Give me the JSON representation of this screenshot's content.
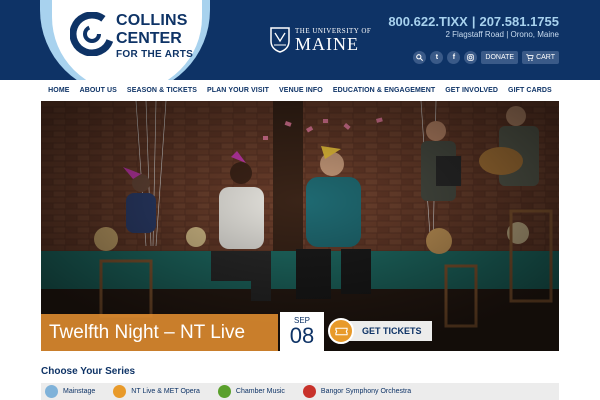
{
  "brand": {
    "logo_line1": "COLLINS",
    "logo_line2": "CENTER",
    "logo_line3": "FOR THE ARTS",
    "university_small": "THE UNIVERSITY OF",
    "university_big": "MAINE"
  },
  "contact": {
    "phone1": "800.622.TIXX",
    "separator": "|",
    "phone2": "207.581.1755",
    "address": "2 Flagstaff Road  |  Orono, Maine"
  },
  "tools": {
    "search_icon": "search-icon",
    "twitter_label": "t",
    "facebook_label": "f",
    "instagram_icon": "instagram-icon",
    "donate_label": "DONATE",
    "cart_label": "CART"
  },
  "nav": {
    "items": [
      "HOME",
      "ABOUT US",
      "SEASON & TICKETS",
      "PLAN YOUR VISIT",
      "VENUE INFO",
      "EDUCATION & ENGAGEMENT",
      "GET INVOLVED",
      "GIFT CARDS"
    ]
  },
  "hero": {
    "title": "Twelfth Night – NT Live",
    "month": "SEP",
    "day": "08",
    "ticket_label": "GET TICKETS"
  },
  "series": {
    "heading": "Choose Your Series",
    "items": [
      {
        "label": "Mainstage",
        "color": "#7fb2d9"
      },
      {
        "label": "NT Live & MET Opera",
        "color": "#e89a2a"
      },
      {
        "label": "Chamber Music",
        "color": "#5aa02c"
      },
      {
        "label": "Bangor Symphony Orchestra",
        "color": "#c8322b"
      }
    ]
  },
  "colors": {
    "header_bg": "#0e3366",
    "accent_light": "#a8d2ee",
    "accent_orange": "#e89a2a"
  }
}
